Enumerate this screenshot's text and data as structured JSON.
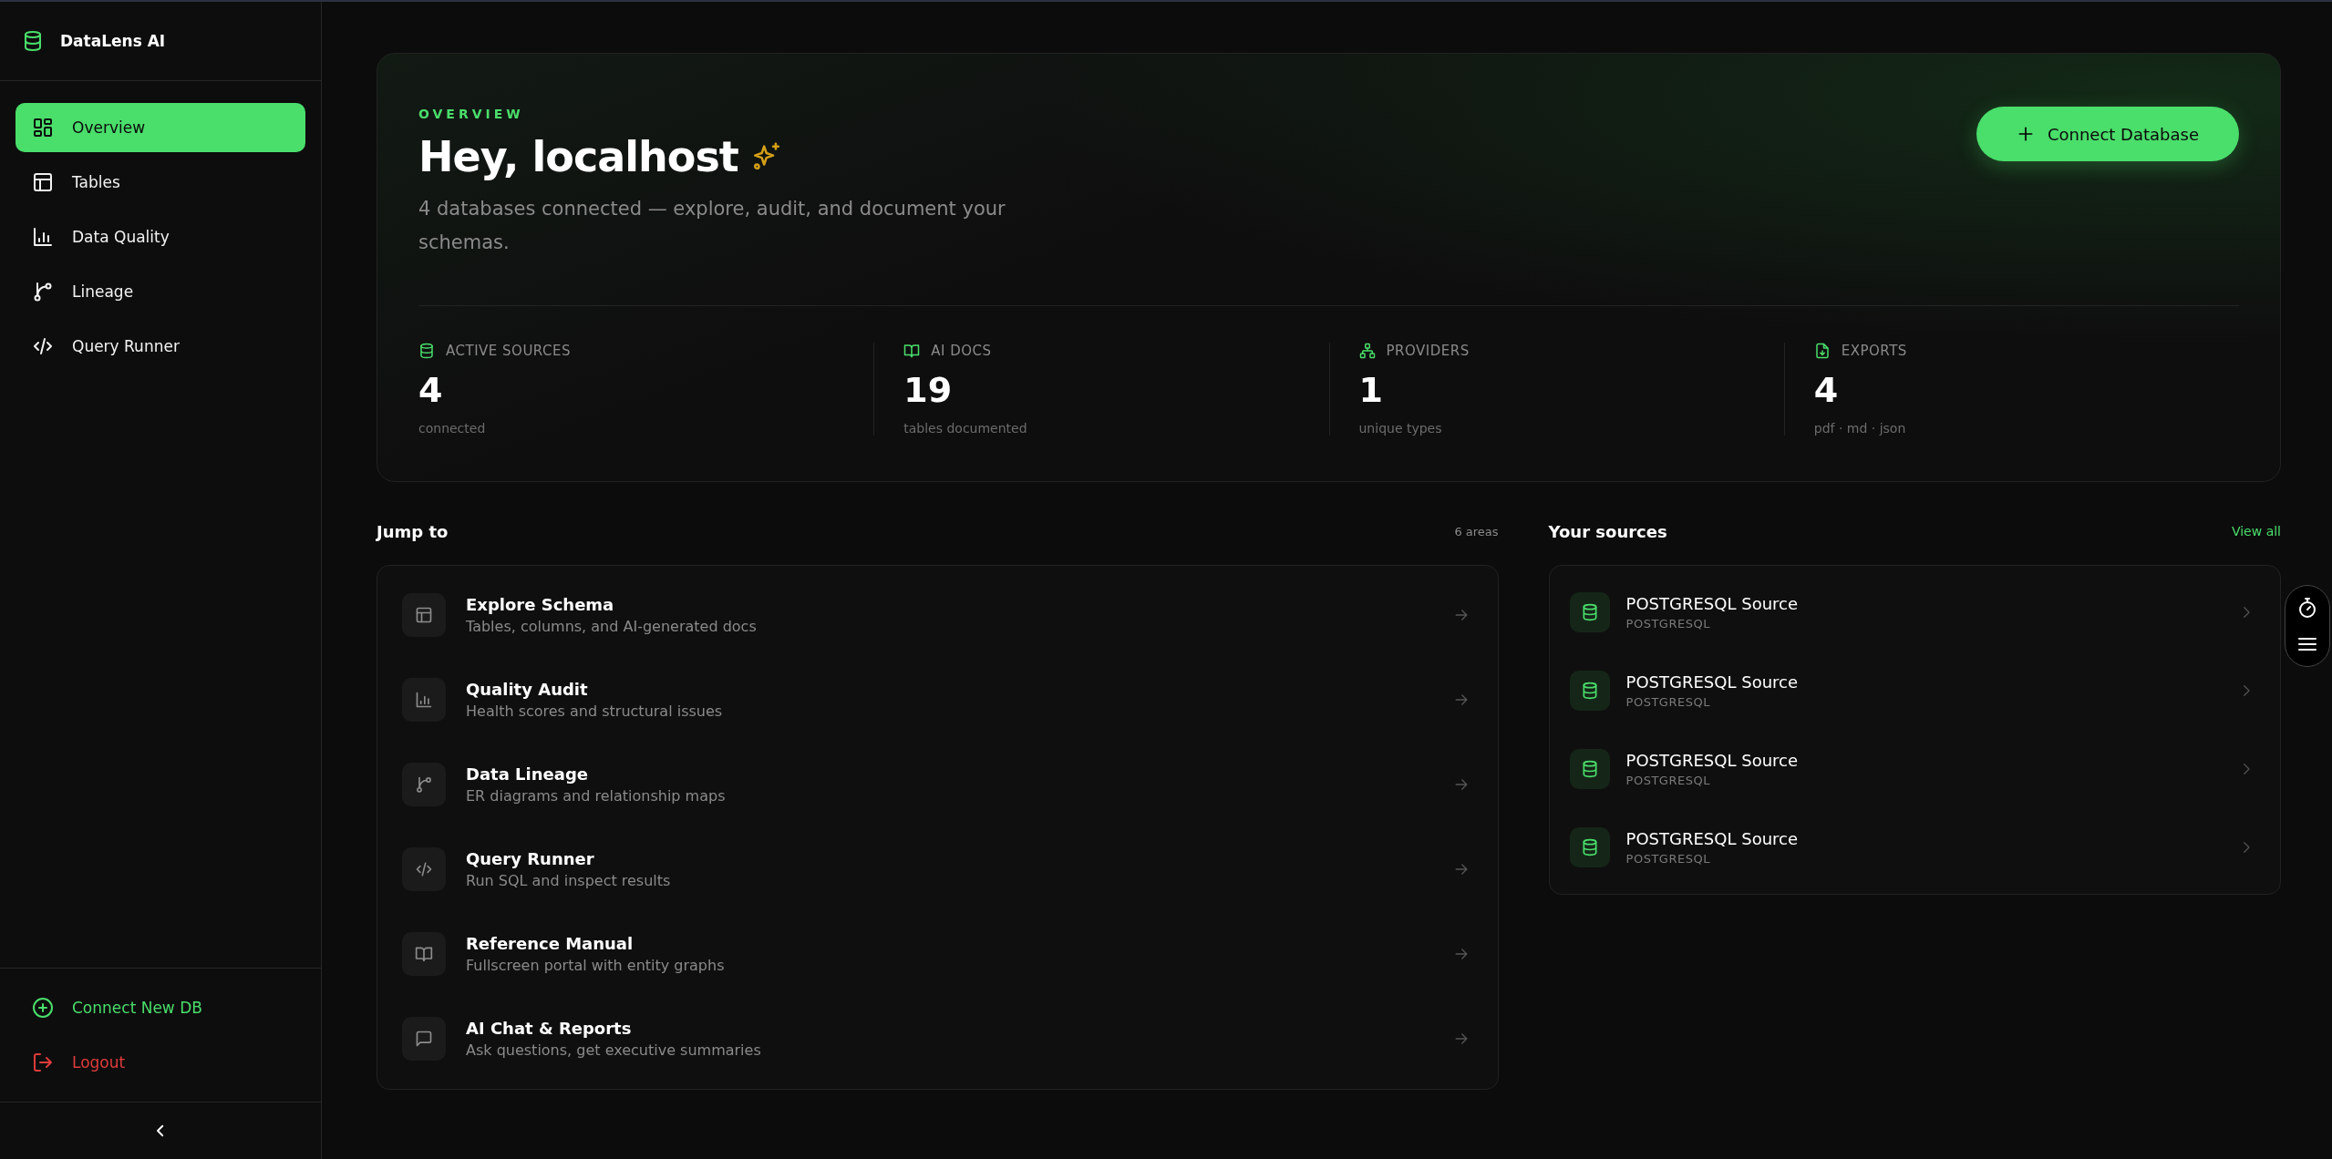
{
  "brand": {
    "name": "DataLens AI"
  },
  "nav": [
    {
      "label": "Overview",
      "selected": true
    },
    {
      "label": "Tables",
      "selected": false
    },
    {
      "label": "Data Quality",
      "selected": false
    },
    {
      "label": "Lineage",
      "selected": false
    },
    {
      "label": "Query Runner",
      "selected": false
    }
  ],
  "sidebar_actions": [
    {
      "label": "Connect New DB",
      "kind": "connect"
    },
    {
      "label": "Logout",
      "kind": "logout"
    }
  ],
  "hero": {
    "eyebrow": "OVERVIEW",
    "title": "Hey, localhost",
    "subtitle": "4 databases connected — explore, audit, and document your schemas.",
    "button": "Connect Database"
  },
  "stats": [
    {
      "label": "ACTIVE SOURCES",
      "value": "4",
      "note": "connected"
    },
    {
      "label": "AI DOCS",
      "value": "19",
      "note": "tables documented"
    },
    {
      "label": "PROVIDERS",
      "value": "1",
      "note": "unique types"
    },
    {
      "label": "EXPORTS",
      "value": "4",
      "note": "pdf · md · json"
    }
  ],
  "jump_to": {
    "title": "Jump to",
    "count": "6 areas",
    "items": [
      {
        "title": "Explore Schema",
        "description": "Tables, columns, and AI-generated docs"
      },
      {
        "title": "Quality Audit",
        "description": "Health scores and structural issues"
      },
      {
        "title": "Data Lineage",
        "description": "ER diagrams and relationship maps"
      },
      {
        "title": "Query Runner",
        "description": "Run SQL and inspect results"
      },
      {
        "title": "Reference Manual",
        "description": "Fullscreen portal with entity graphs"
      },
      {
        "title": "AI Chat & Reports",
        "description": "Ask questions, get executive summaries"
      }
    ]
  },
  "sources": {
    "title": "Your sources",
    "link": "View all",
    "items": [
      {
        "name": "POSTGRESQL Source",
        "type": "POSTGRESQL"
      },
      {
        "name": "POSTGRESQL Source",
        "type": "POSTGRESQL"
      },
      {
        "name": "POSTGRESQL Source",
        "type": "POSTGRESQL"
      },
      {
        "name": "POSTGRESQL Source",
        "type": "POSTGRESQL"
      }
    ]
  }
}
